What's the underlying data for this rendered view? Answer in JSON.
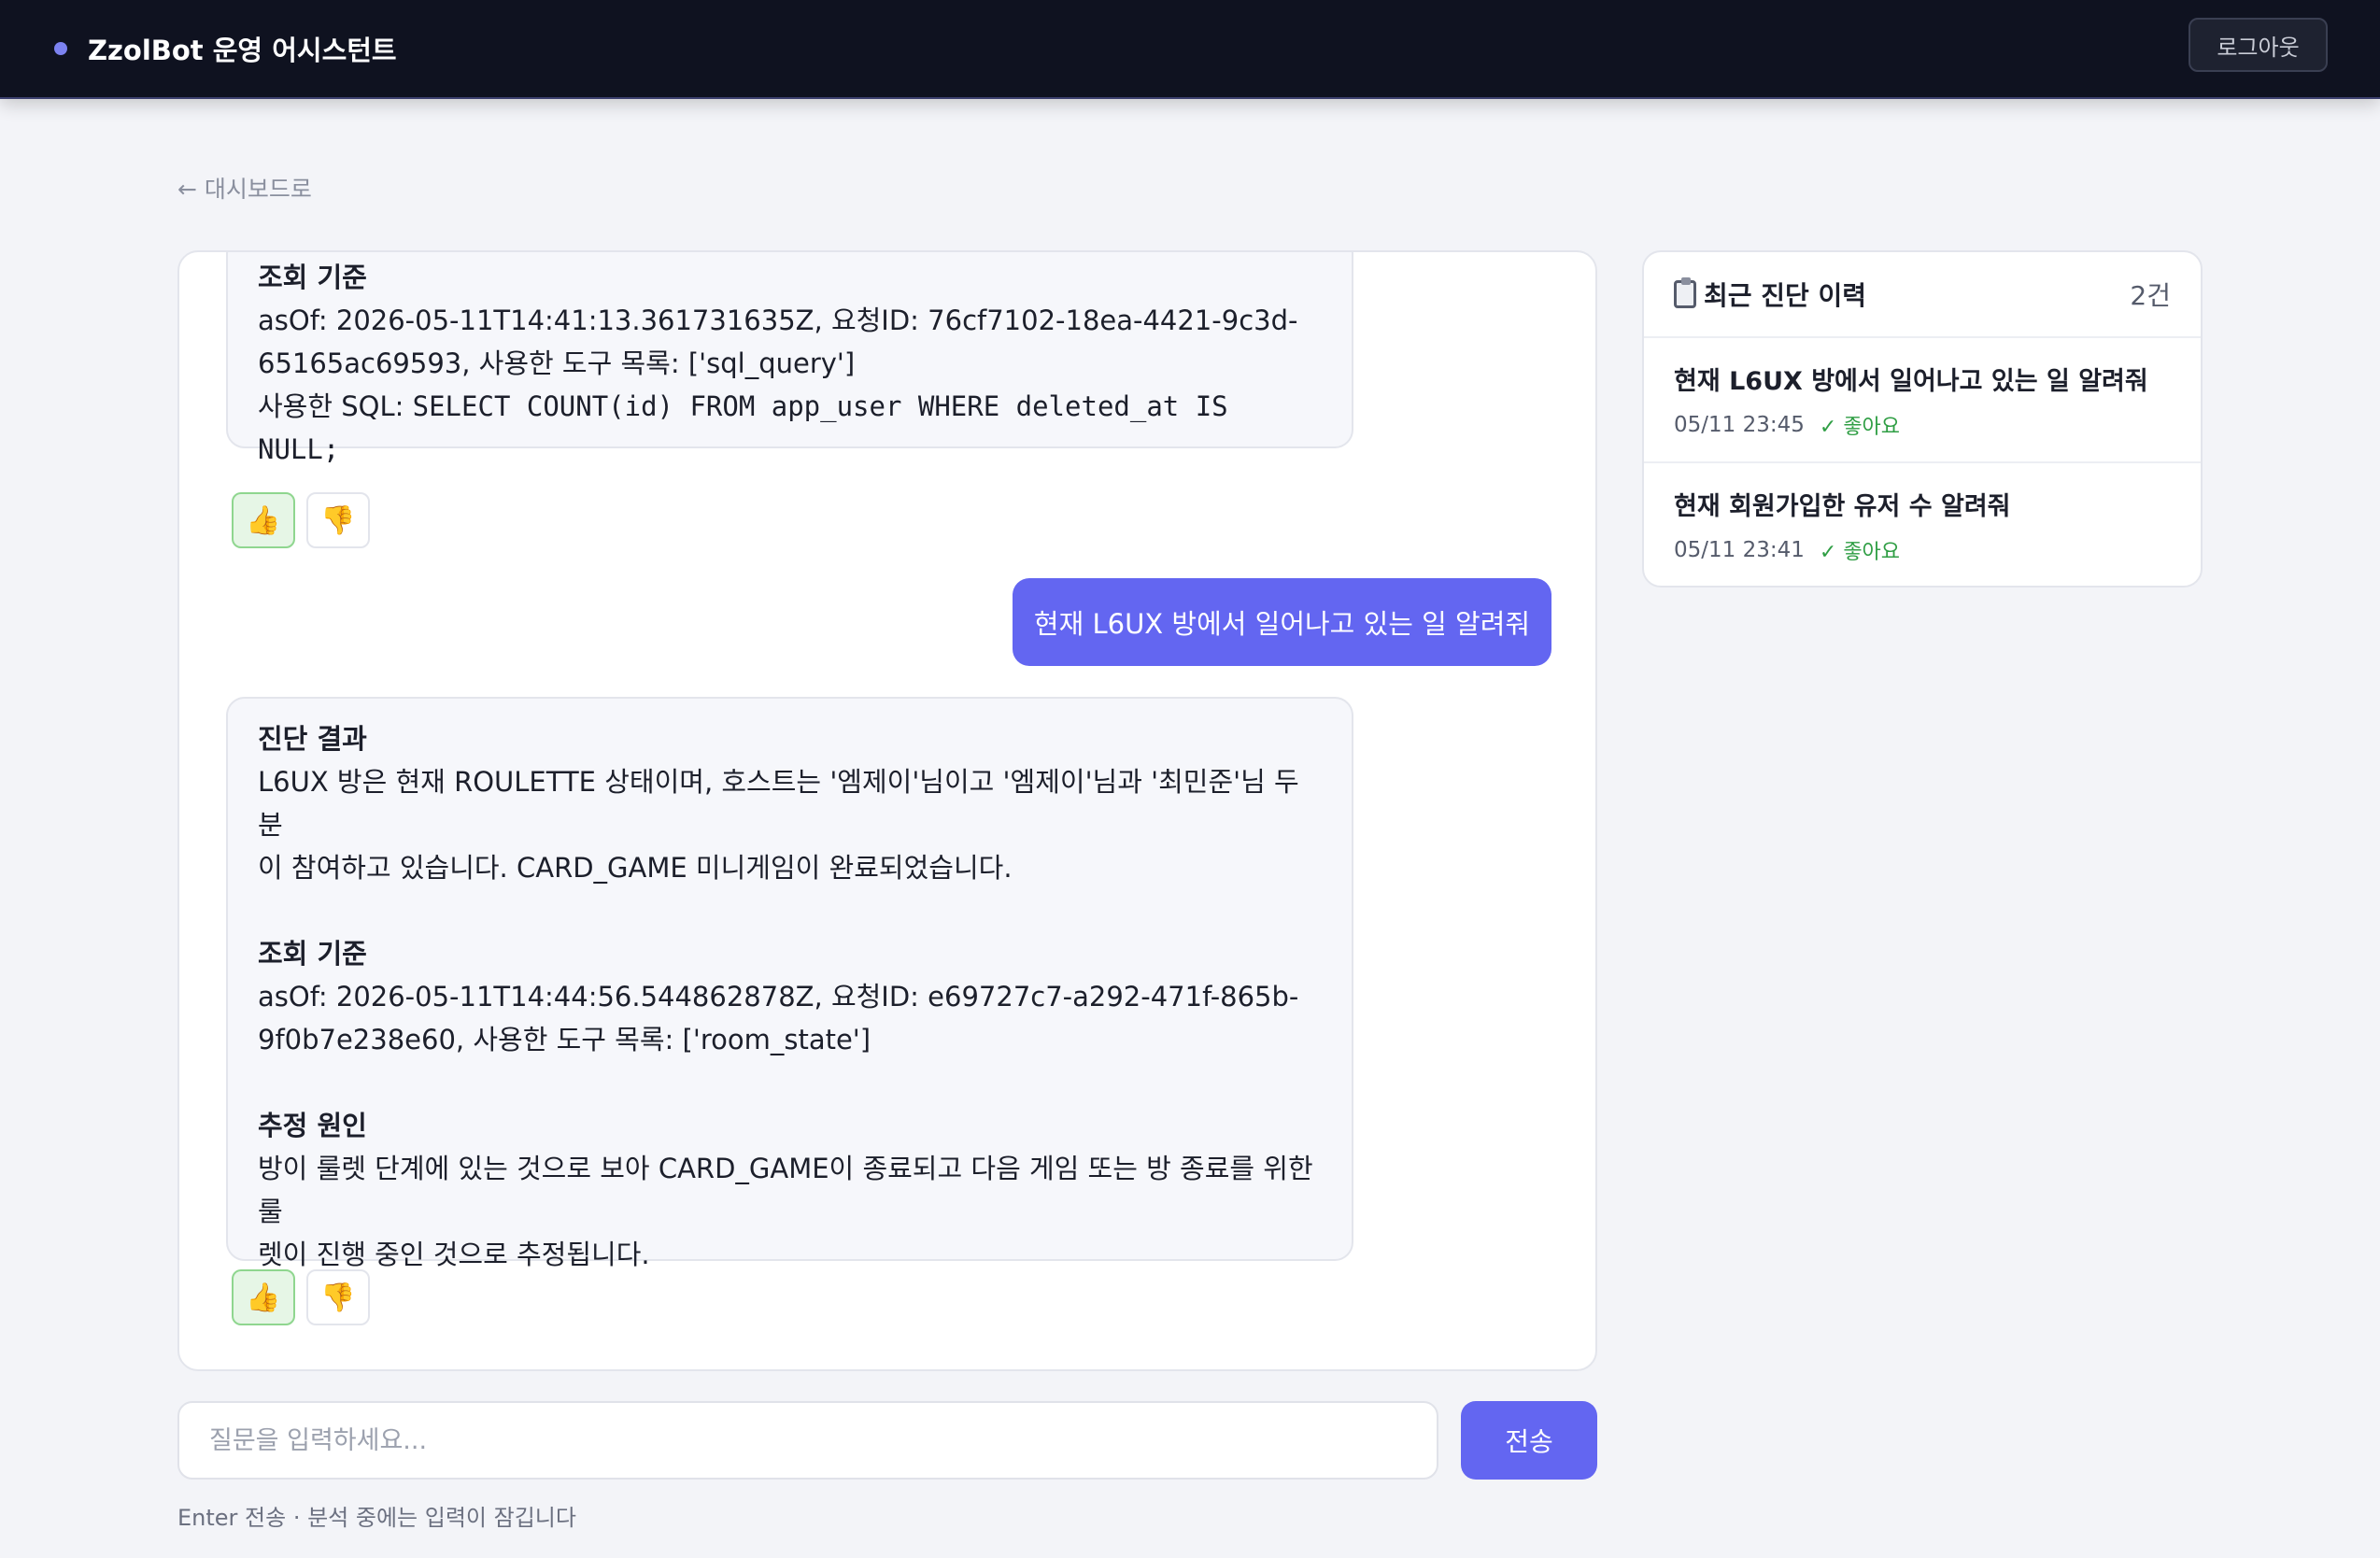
{
  "app": {
    "title": "ZzolBot 운영 어시스턴트",
    "logout_label": "로그아웃"
  },
  "nav": {
    "back_label": "← 대시보드로"
  },
  "chat": {
    "message1": {
      "section_title": "조회 기준",
      "lines": [
        "asOf: 2026-05-11T14:41:13.361731635Z, 요청ID: 76cf7102-18ea-4421-9c3d-",
        "65165ac69593, 사용한 도구 목록: ['sql_query']"
      ],
      "sql_prefix": "사용한 SQL: ",
      "sql": "SELECT COUNT(id) FROM app_user WHERE deleted_at IS NULL;"
    },
    "user_message": "현재 L6UX 방에서 일어나고 있는 일 알려줘",
    "message2": {
      "result_title": "진단 결과",
      "result_lines": [
        "L6UX 방은 현재 ROULETTE 상태이며, 호스트는 '엠제이'님이고 '엠제이'님과 '최민준'님 두 분",
        "이 참여하고 있습니다. CARD_GAME 미니게임이 완료되었습니다."
      ],
      "basis_title": "조회 기준",
      "basis_lines": [
        "asOf: 2026-05-11T14:44:56.544862878Z, 요청ID: e69727c7-a292-471f-865b-",
        "9f0b7e238e60, 사용한 도구 목록: ['room_state']"
      ],
      "cause_title": "추정 원인",
      "cause_lines": [
        "방이 룰렛 단계에 있는 것으로 보아 CARD_GAME이 종료되고 다음 게임 또는 방 종료를 위한 룰",
        "렛이 진행 중인 것으로 추정됩니다."
      ]
    },
    "feedback": {
      "like": "👍",
      "dislike": "👎"
    }
  },
  "history": {
    "title": "최근 진단 이력",
    "count": "2건",
    "items": [
      {
        "question": "현재 L6UX 방에서 일어나고 있는 일 알려줘",
        "time": "05/11 23:45",
        "status": "✓ 좋아요"
      },
      {
        "question": "현재 회원가입한 유저 수 알려줘",
        "time": "05/11 23:41",
        "status": "✓ 좋아요"
      }
    ]
  },
  "composer": {
    "placeholder": "질문을 입력하세요...",
    "send_label": "전송",
    "hint": "Enter 전송 · 분석 중에는 입력이 잠깁니다"
  }
}
